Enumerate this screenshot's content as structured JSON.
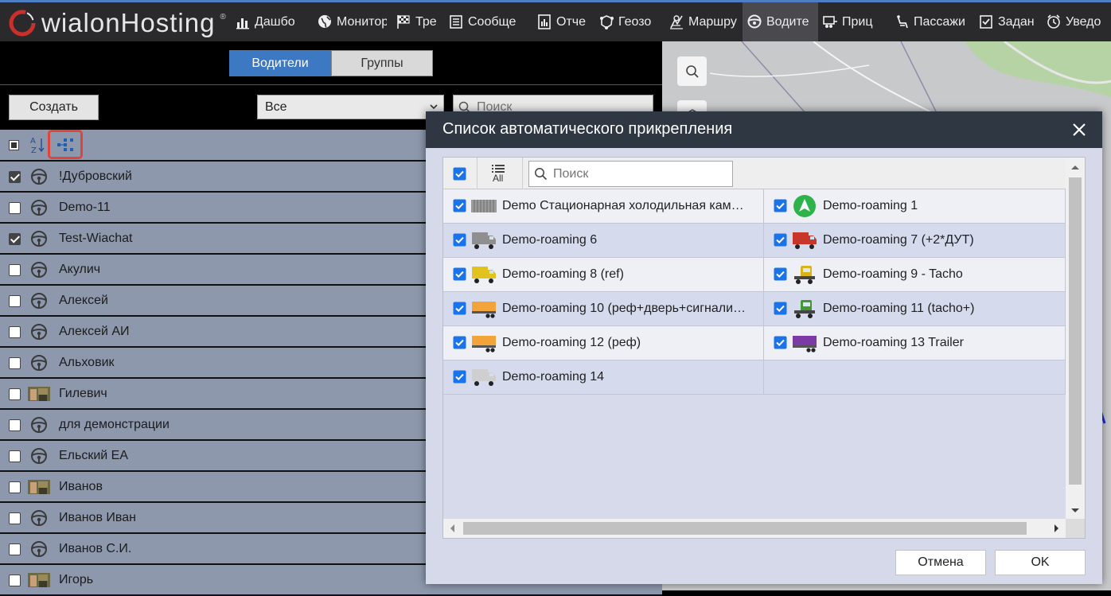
{
  "app": {
    "logo": "wialonHosting",
    "logo_sup": "®",
    "nav": [
      {
        "label": "Дашбо",
        "icon": "bar-chart-icon"
      },
      {
        "label": "Монитор",
        "icon": "globe-icon"
      },
      {
        "label": "Тре",
        "icon": "checkered-flag-icon"
      },
      {
        "label": "Сообще",
        "icon": "message-list-icon"
      },
      {
        "label": "Отче",
        "icon": "report-icon"
      },
      {
        "label": "Геозо",
        "icon": "geofence-icon"
      },
      {
        "label": "Маршру",
        "icon": "route-icon"
      },
      {
        "label": "Водите",
        "icon": "steering-wheel-icon",
        "active": true
      },
      {
        "label": "Приц",
        "icon": "trailer-icon"
      },
      {
        "label": "Пассажи",
        "icon": "passenger-seat-icon"
      },
      {
        "label": "Задан",
        "icon": "task-check-icon"
      },
      {
        "label": "Уведо",
        "icon": "alarm-clock-icon"
      }
    ]
  },
  "left": {
    "tabs": [
      "Водители",
      "Группы"
    ],
    "create_label": "Создать",
    "filter_value": "Все",
    "search_placeholder": "Поиск",
    "drivers": [
      {
        "name": "!Дубровский",
        "checked": true,
        "avatar": "wheel"
      },
      {
        "name": "Demo-11",
        "checked": false,
        "avatar": "wheel"
      },
      {
        "name": "Test-Wiachat",
        "checked": true,
        "avatar": "wheel"
      },
      {
        "name": "Акулич",
        "checked": false,
        "avatar": "wheel"
      },
      {
        "name": "Алексей",
        "checked": false,
        "avatar": "wheel"
      },
      {
        "name": "Алексей АИ",
        "checked": false,
        "avatar": "wheel"
      },
      {
        "name": "Альховик",
        "checked": false,
        "avatar": "wheel"
      },
      {
        "name": "Гилевич",
        "checked": false,
        "avatar": "photo"
      },
      {
        "name": "для демонстрации",
        "checked": false,
        "avatar": "wheel"
      },
      {
        "name": "Ельский ЕА",
        "checked": false,
        "avatar": "wheel"
      },
      {
        "name": "Иванов",
        "checked": false,
        "avatar": "photo"
      },
      {
        "name": "Иванов Иван",
        "checked": false,
        "avatar": "wheel"
      },
      {
        "name": "Иванов С.И.",
        "checked": false,
        "avatar": "wheel"
      },
      {
        "name": "Игорь",
        "checked": false,
        "avatar": "photo"
      }
    ]
  },
  "modal": {
    "title": "Список автоматического прикрепления",
    "all_label": "All",
    "search_placeholder": "Поиск",
    "units": [
      {
        "name": "Demo Стационарная холодильная кам…",
        "icon": "container-icon",
        "color": "#9a9a9a"
      },
      {
        "name": "Demo-roaming 1",
        "icon": "green-arrow-icon",
        "color": "#2db34a"
      },
      {
        "name": "Demo-roaming 6",
        "icon": "grey-truck-icon",
        "color": "#8f8f8f"
      },
      {
        "name": "Demo-roaming 7 (+2*ДУТ)",
        "icon": "red-truck-icon",
        "color": "#c8352b"
      },
      {
        "name": "Demo-roaming 8 (ref)",
        "icon": "yellow-truck-icon",
        "color": "#e2c21c"
      },
      {
        "name": "Demo-roaming 9 - Tacho",
        "icon": "yellow-tractor-icon",
        "color": "#d8b41a"
      },
      {
        "name": "Demo-roaming 10 (реф+дверь+сигнали…",
        "icon": "orange-trailer-icon",
        "color": "#f2a43a"
      },
      {
        "name": "Demo-roaming 11 (tacho+)",
        "icon": "green-tractor-icon",
        "color": "#3f9a35"
      },
      {
        "name": "Demo-roaming 12 (реф)",
        "icon": "orange-trailer-icon",
        "color": "#f2a43a"
      },
      {
        "name": "Demo-roaming 13 Trailer",
        "icon": "purple-trailer-icon",
        "color": "#7b3aa6"
      },
      {
        "name": "Demo-roaming 14",
        "icon": "white-truck-icon",
        "color": "#cfcfcf"
      }
    ],
    "cancel_label": "Отмена",
    "ok_label": "OK"
  },
  "colors": {
    "accent": "#3d79c3",
    "header_dark": "#2e3742",
    "row_bg": "#8d98ad",
    "checkbox_blue": "#1a73e8",
    "highlight_red": "#e0443a"
  }
}
